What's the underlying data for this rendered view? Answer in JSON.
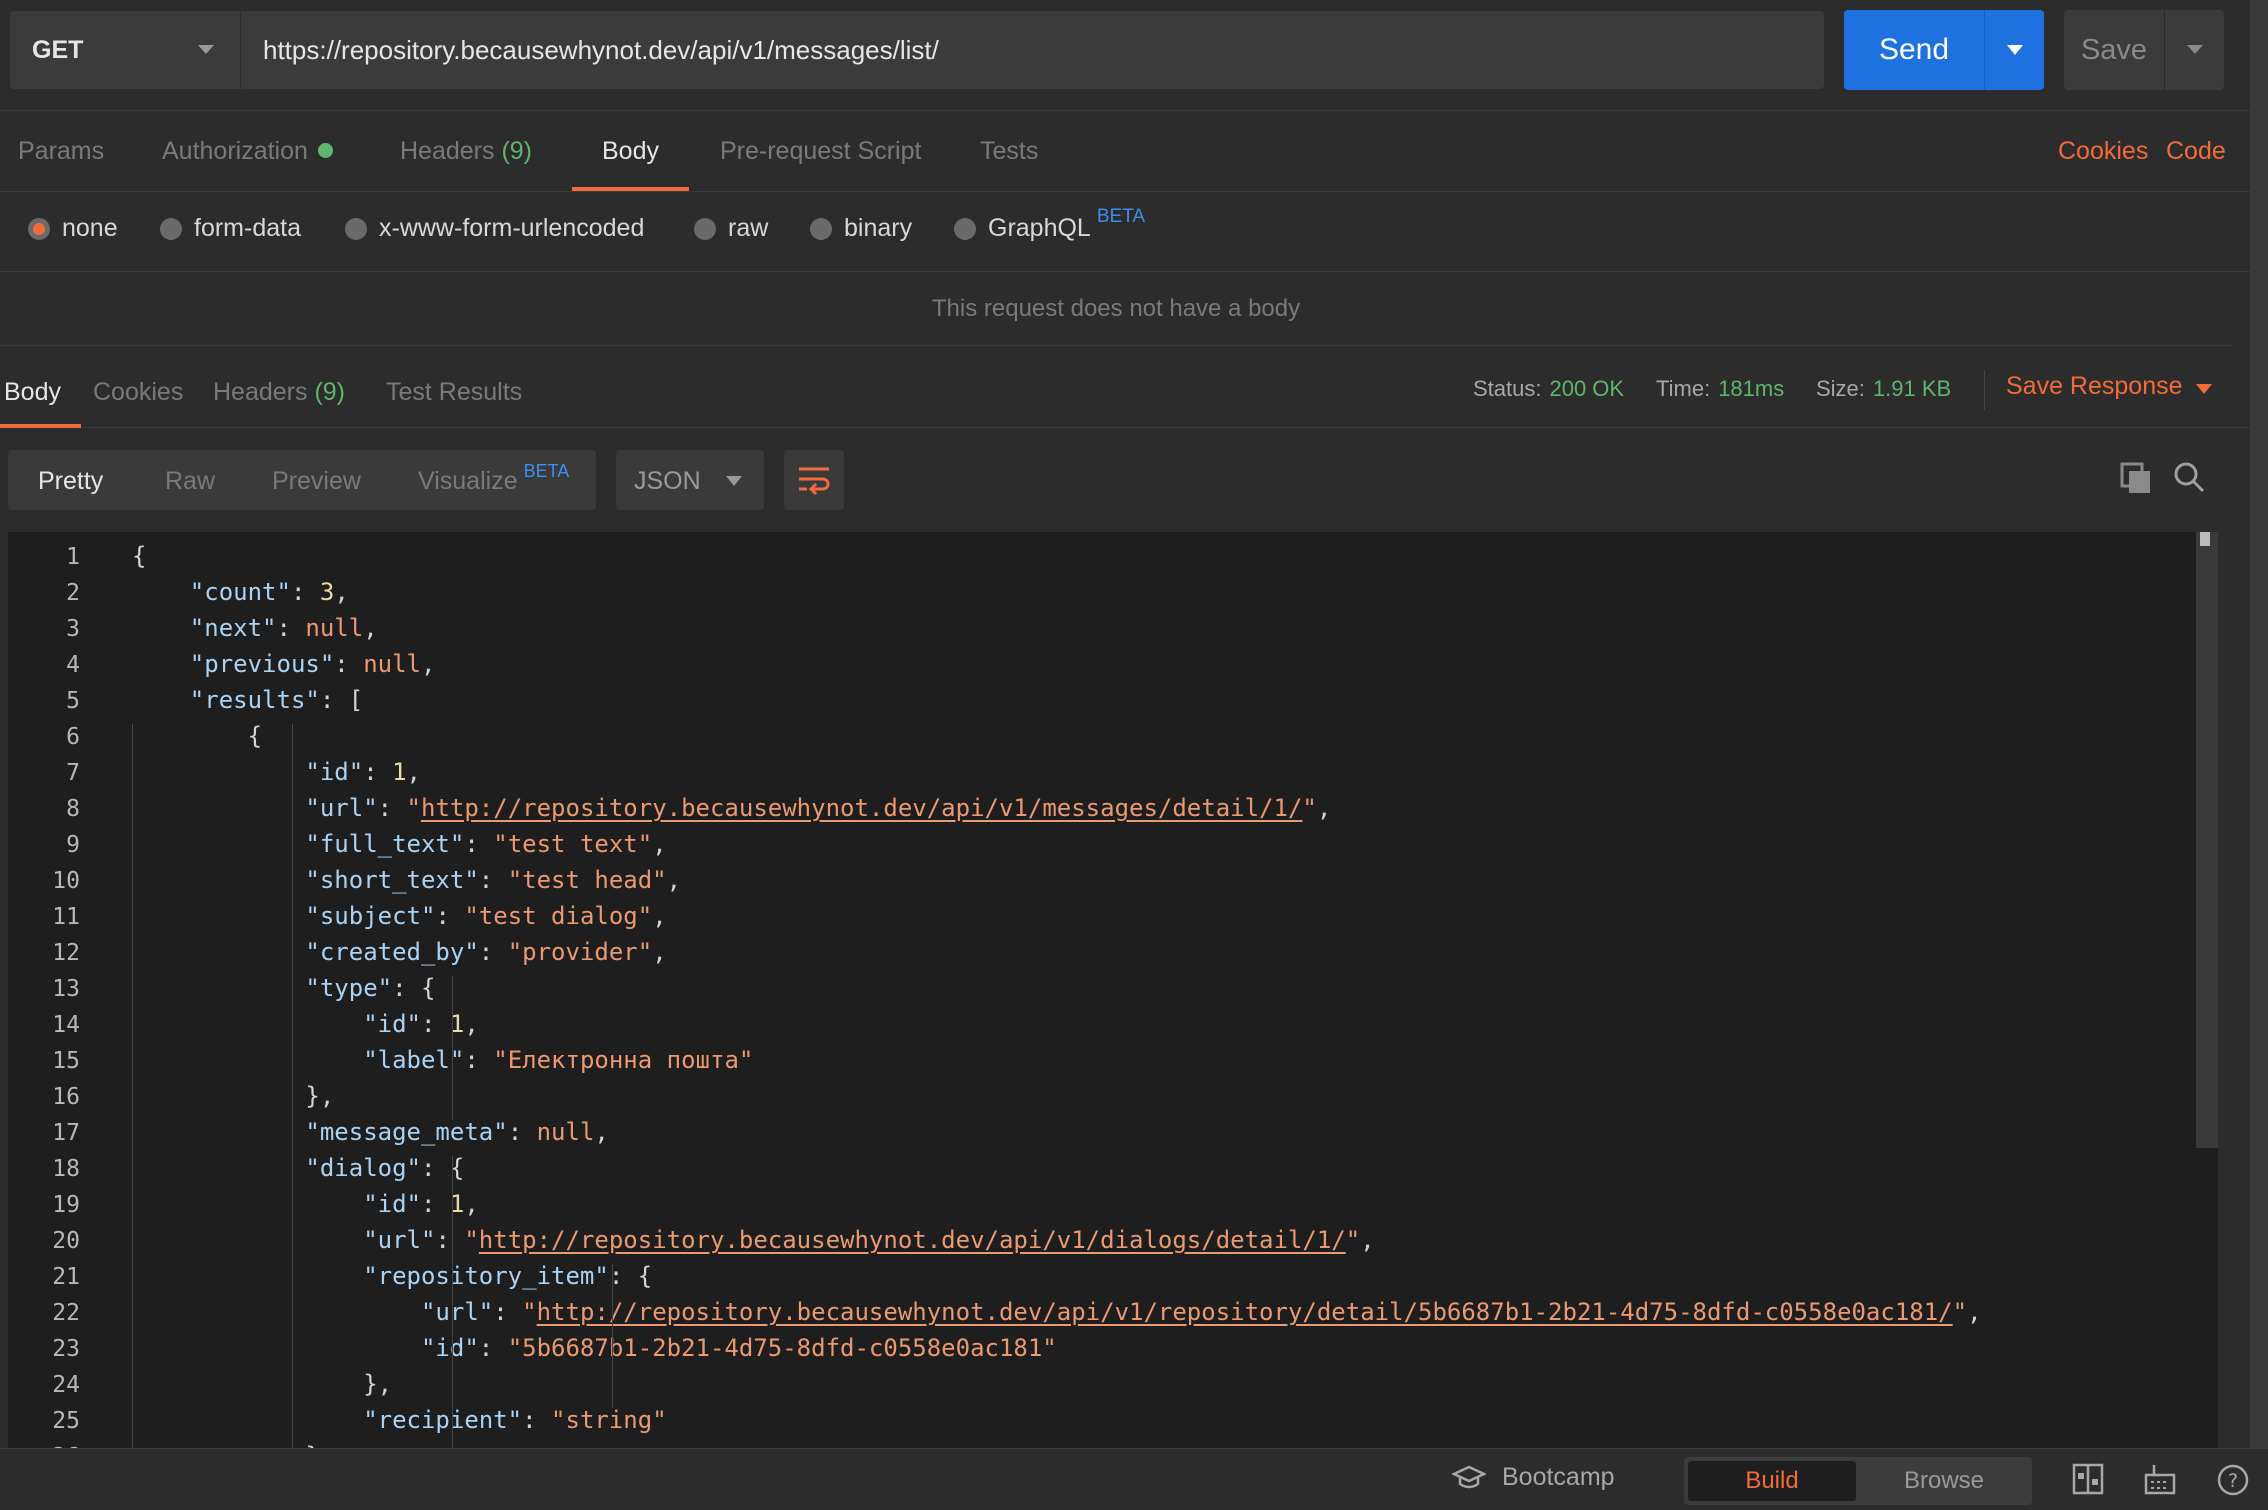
{
  "request": {
    "method": "GET",
    "url": "https://repository.becausewhynot.dev/api/v1/messages/list/",
    "send_label": "Send",
    "save_label": "Save"
  },
  "request_tabs": [
    {
      "label": "Params"
    },
    {
      "label": "Authorization"
    },
    {
      "label": "Headers",
      "count": "(9)"
    },
    {
      "label": "Body"
    },
    {
      "label": "Pre-request Script"
    },
    {
      "label": "Tests"
    }
  ],
  "request_links": {
    "cookies": "Cookies",
    "code": "Code"
  },
  "body_types": [
    "none",
    "form-data",
    "x-www-form-urlencoded",
    "raw",
    "binary",
    "GraphQL"
  ],
  "beta_label": "BETA",
  "no_body_text": "This request does not have a body",
  "response_tabs": [
    {
      "label": "Body"
    },
    {
      "label": "Cookies"
    },
    {
      "label": "Headers",
      "count": "(9)"
    },
    {
      "label": "Test Results"
    }
  ],
  "response_stats": {
    "status_label": "Status:",
    "status_value": "200 OK",
    "time_label": "Time:",
    "time_value": "181ms",
    "size_label": "Size:",
    "size_value": "1.91 KB",
    "save_response": "Save Response"
  },
  "view_modes": [
    "Pretty",
    "Raw",
    "Preview",
    "Visualize"
  ],
  "format": "JSON",
  "colors": {
    "accent": "#f26b3a",
    "send": "#1e72e0",
    "success": "#5fb56d",
    "beta": "#3d8ef0"
  },
  "code_lines": [
    "{",
    "    \"count\": 3,",
    "    \"next\": null,",
    "    \"previous\": null,",
    "    \"results\": [",
    "        {",
    "            \"id\": 1,",
    "            \"url\": \"http://repository.becausewhynot.dev/api/v1/messages/detail/1/\",",
    "            \"full_text\": \"test text\",",
    "            \"short_text\": \"test head\",",
    "            \"subject\": \"test dialog\",",
    "            \"created_by\": \"provider\",",
    "            \"type\": {",
    "                \"id\": 1,",
    "                \"label\": \"Електронна пошта\"",
    "            },",
    "            \"message_meta\": null,",
    "            \"dialog\": {",
    "                \"id\": 1,",
    "                \"url\": \"http://repository.becausewhynot.dev/api/v1/dialogs/detail/1/\",",
    "                \"repository_item\": {",
    "                    \"url\": \"http://repository.becausewhynot.dev/api/v1/repository/detail/5b6687b1-2b21-4d75-8dfd-c0558e0ac181/\",",
    "                    \"id\": \"5b6687b1-2b21-4d75-8dfd-c0558e0ac181\"",
    "                },",
    "                \"recipient\": \"string\"",
    "            }"
  ],
  "statusbar": {
    "bootcamp": "Bootcamp",
    "build": "Build",
    "browse": "Browse"
  }
}
